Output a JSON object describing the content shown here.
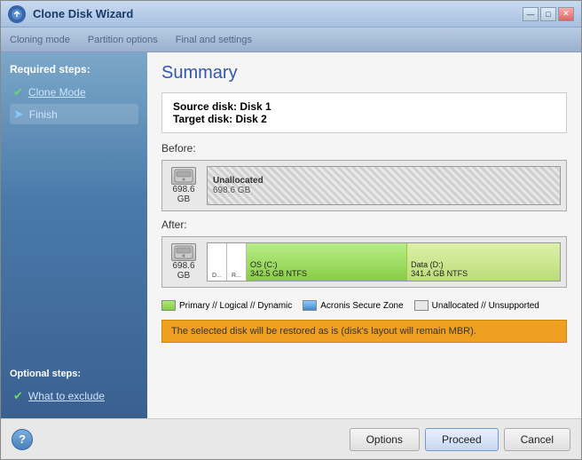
{
  "window": {
    "title": "Clone Disk Wizard",
    "titlebar_buttons": [
      "—",
      "□",
      "✕"
    ]
  },
  "wizard_nav": {
    "steps": [
      "Cloning mode",
      "Partition options",
      "Final and settings"
    ]
  },
  "sidebar": {
    "required_label": "Required steps:",
    "items": [
      {
        "id": "clone-mode",
        "label": "Clone Mode",
        "status": "check"
      },
      {
        "id": "finish",
        "label": "Finish",
        "status": "arrow"
      }
    ],
    "optional_label": "Optional steps:",
    "optional_items": [
      {
        "id": "what-to-exclude",
        "label": "What to exclude",
        "status": "check"
      }
    ]
  },
  "content": {
    "title": "Summary",
    "source_disk": "Source disk: Disk 1",
    "target_disk": "Target disk: Disk 2",
    "before_label": "Before:",
    "before_disk": {
      "size": "698.6 GB",
      "partition_label": "Unallocated",
      "partition_size": "698.6 GB"
    },
    "after_label": "After:",
    "after_disk": {
      "size": "698.6 GB",
      "partitions": [
        {
          "id": "sys1",
          "label": "D..."
        },
        {
          "id": "sys2",
          "label": "R..."
        },
        {
          "id": "c",
          "label": "OS (C:)",
          "size": "342.5 GB",
          "fs": "NTFS"
        },
        {
          "id": "d",
          "label": "Data (D:)",
          "size": "341.4 GB",
          "fs": "NTFS"
        }
      ]
    },
    "legend": [
      {
        "id": "primary",
        "color": "primary",
        "label": "Primary // Logical // Dynamic"
      },
      {
        "id": "acronis",
        "color": "acronis",
        "label": "Acronis Secure Zone"
      },
      {
        "id": "unalloc",
        "color": "unalloc",
        "label": "Unallocated // Unsupported"
      }
    ],
    "warning": "The selected disk will be restored as is (disk's layout will remain MBR)."
  },
  "footer": {
    "help_label": "?",
    "buttons": [
      {
        "id": "options",
        "label": "Options"
      },
      {
        "id": "proceed",
        "label": "Proceed"
      },
      {
        "id": "cancel",
        "label": "Cancel"
      }
    ]
  }
}
